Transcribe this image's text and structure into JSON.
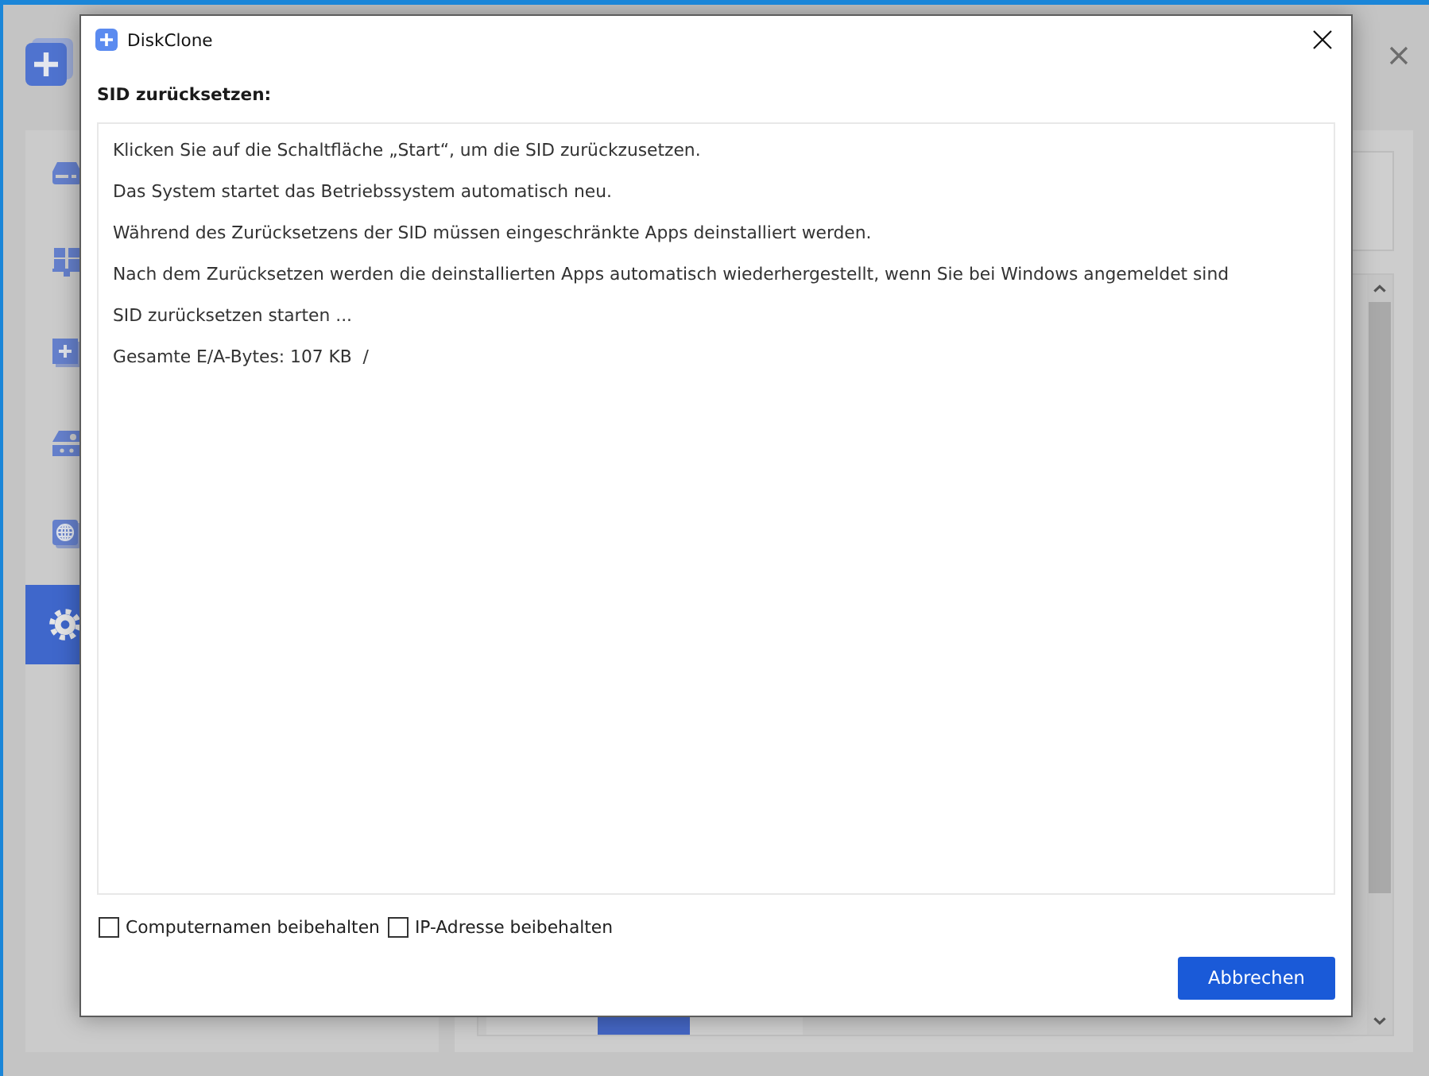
{
  "background": {
    "sidebar": {
      "items": [
        {
          "kind": "disk",
          "selected": false
        },
        {
          "kind": "apps",
          "selected": false
        },
        {
          "kind": "add",
          "selected": false
        },
        {
          "kind": "drive",
          "selected": false
        },
        {
          "kind": "network",
          "selected": false
        },
        {
          "kind": "settings",
          "selected": true
        }
      ]
    }
  },
  "dialog": {
    "title": "DiskClone",
    "heading": "SID zurücksetzen:",
    "log_lines": [
      "Klicken Sie auf die Schaltfläche „Start“, um die SID zurückzusetzen.",
      "Das System startet das Betriebssystem automatisch neu.",
      "Während des Zurücksetzens der SID müssen eingeschränkte Apps deinstalliert werden.",
      "Nach dem Zurücksetzen werden die deinstallierten Apps automatisch wiederhergestellt, wenn Sie bei Windows angemeldet sind",
      "SID zurücksetzen starten ...",
      "Gesamte E/A-Bytes: 107 KB  /"
    ],
    "options": [
      {
        "label": "Computernamen beibehalten",
        "checked": false
      },
      {
        "label": "IP-Adresse beibehalten",
        "checked": false
      }
    ],
    "buttons": [
      "Abbrechen"
    ]
  }
}
